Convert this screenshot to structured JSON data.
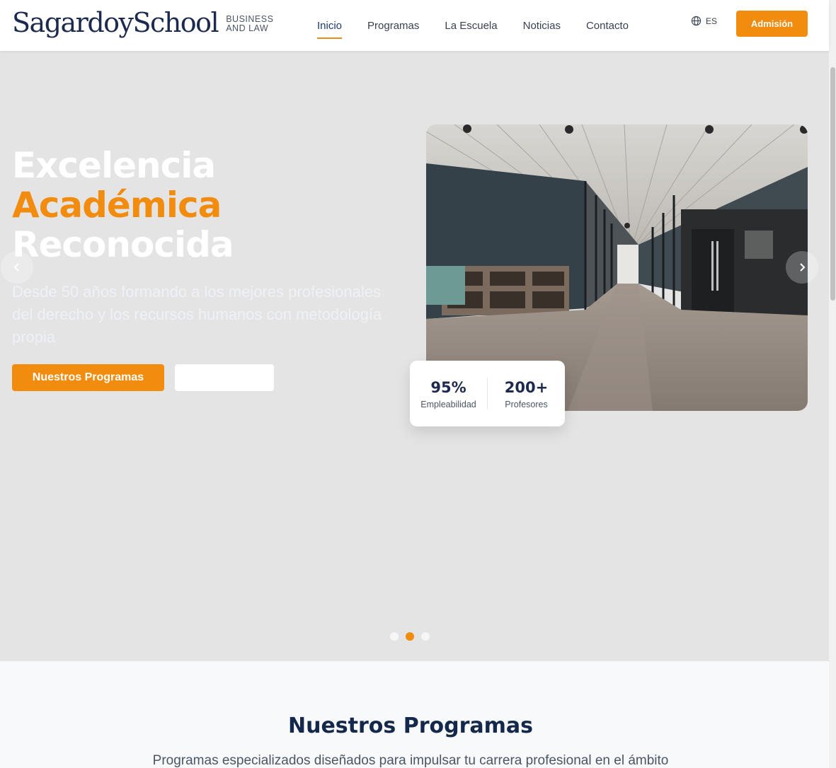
{
  "header": {
    "logo_text": "SagardoySchool",
    "logo_sub_line1": "BUSINESS",
    "logo_sub_line2": "AND LAW",
    "nav": [
      {
        "label": "Inicio",
        "active": true
      },
      {
        "label": "Programas"
      },
      {
        "label": "La Escuela"
      },
      {
        "label": "Noticias"
      },
      {
        "label": "Contacto"
      }
    ],
    "language": "ES",
    "admission_label": "Admisión"
  },
  "hero": {
    "title_line1": "Excelencia",
    "title_line2": "Académica",
    "title_line3": "Reconocida",
    "description": "Desde 50 años formando a los mejores profesionales del derecho y los recursos humanos con metodología propia",
    "primary_button": "Nuestros Programas",
    "secondary_button": "",
    "stats": [
      {
        "value": "95%",
        "label": "Empleabilidad"
      },
      {
        "value": "200+",
        "label": "Profesores"
      }
    ],
    "slides": 3,
    "active_slide": 2
  },
  "programs": {
    "title": "Nuestros Programas",
    "description": "Programas especializados diseñados para impulsar tu carrera profesional en el ámbito"
  },
  "colors": {
    "accent": "#f18c0e",
    "navy": "#1b2a4e",
    "hero_bg": "#e4e4e4"
  }
}
